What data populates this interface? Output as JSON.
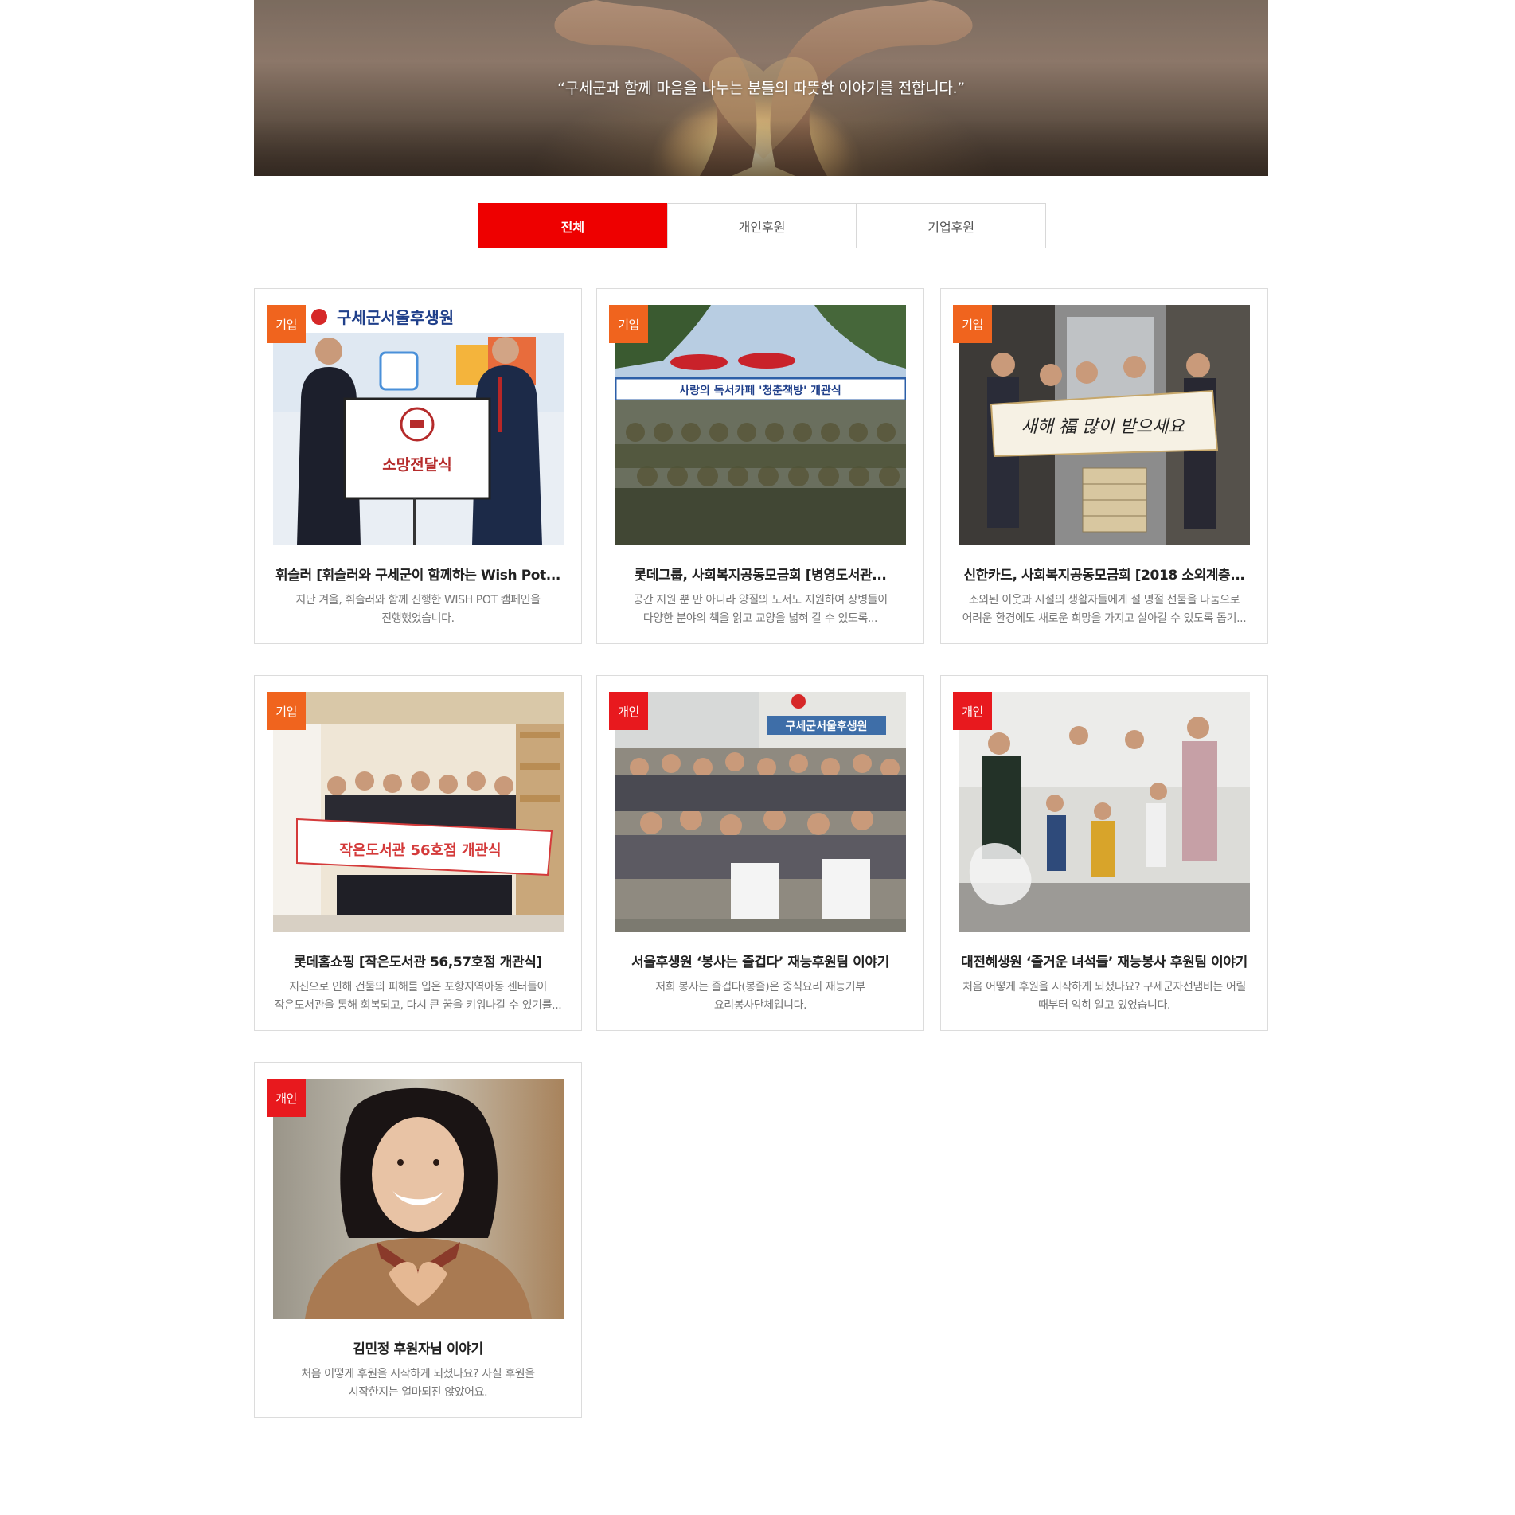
{
  "hero": {
    "quote": "“구세군과 함께 마음을 나누는 분들의 따뜻한 이야기를 전합니다.”"
  },
  "tabs": [
    {
      "label": "전체",
      "active": true
    },
    {
      "label": "개인후원",
      "active": false
    },
    {
      "label": "기업후원",
      "active": false
    }
  ],
  "cards": [
    {
      "category": "기업",
      "title": "휘슬러 [휘슬러와 구세군이 함께하는 Wish Pot...",
      "desc": [
        "지난 겨울, 휘슬러와 함께 진행한 WISH POT 캠페인을",
        "진행했었습니다."
      ],
      "photo_text": [
        "구세군서울후생원",
        "소망전달식"
      ]
    },
    {
      "category": "기업",
      "title": "롯데그룹, 사회복지공동모금회 [병영도서관...",
      "desc": [
        "공간 지원 뿐 만 아니라 양질의 도서도 지원하여 장병들이",
        "다양한 분야의 책을 읽고 교양을 넓혀 갈 수 있도록..."
      ],
      "photo_text": [
        "사랑의 독서카페 '청춘책방' 개관식"
      ]
    },
    {
      "category": "기업",
      "title": "신한카드, 사회복지공동모금회 [2018 소외계층...",
      "desc": [
        "소외된 이웃과 시설의 생활자들에게 설 명절 선물을 나눔으로",
        "어려운 환경에도 새로운 희망을 가지고 살아갈 수 있도록 돕기..."
      ],
      "photo_text": [
        "새해 福 많이 받으세요"
      ]
    },
    {
      "category": "기업",
      "title": "롯데홈쇼핑 [작은도서관 56,57호점 개관식]",
      "desc": [
        "지진으로 인해 건물의 피해를 입은 포항지역아동 센터들이",
        "작은도서관을 통해 회복되고, 다시 큰 꿈을 키워나갈 수 있기를..."
      ],
      "photo_text": [
        "작은도서관 56호점 개관식"
      ]
    },
    {
      "category": "개인",
      "title": "서울후생원 ‘봉사는 즐겁다’ 재능후원팀 이야기",
      "desc": [
        "저희 봉사는 즐겁다(봉즐)은 중식요리 재능기부",
        "요리봉사단체입니다."
      ],
      "photo_text": [
        "구세군서울후생원"
      ]
    },
    {
      "category": "개인",
      "title": "대전혜생원 ‘즐거운 녀석들’ 재능봉사 후원팀 이야기",
      "desc": [
        "처음 어떻게 후원을 시작하게 되셨나요? 구세군자선냄비는 어릴",
        "때부터 익히 알고 있었습니다."
      ],
      "photo_text": []
    },
    {
      "category": "개인",
      "title": "김민정 후원자님 이야기",
      "desc": [
        "처음 어떻게 후원을 시작하게 되셨나요? 사실 후원을",
        "시작한지는 얼마되진 않았어요."
      ],
      "photo_text": []
    }
  ],
  "colors": {
    "accent_red": "#ee0000",
    "badge_corp": "#f0641e",
    "badge_indiv": "#e8191e"
  }
}
